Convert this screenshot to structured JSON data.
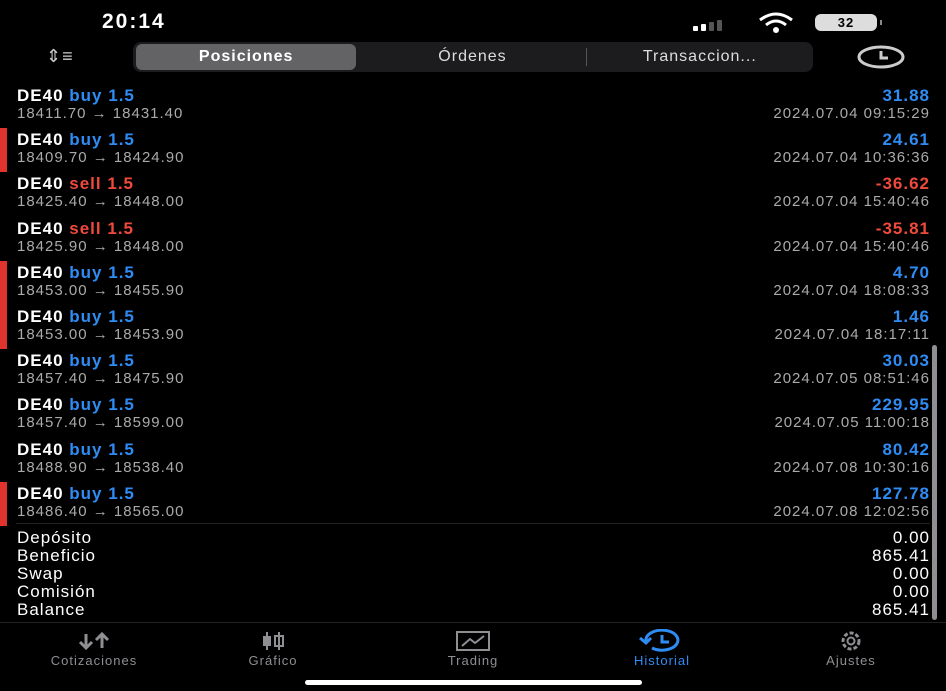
{
  "status": {
    "time": "20:14",
    "battery": "32"
  },
  "toolbar": {
    "tabs": [
      "Posiciones",
      "Órdenes",
      "Transaccion..."
    ],
    "active": 0
  },
  "colors": {
    "buy": "#2f8cf4",
    "sell": "#ef4a3c",
    "marker": "#e0342c"
  },
  "trades": [
    {
      "symbol": "DE40",
      "side": "buy",
      "volume": "1.5",
      "open": "18411.70",
      "close": "18431.40",
      "profit": "31.88",
      "time": "2024.07.04 09:15:29",
      "marked": false
    },
    {
      "symbol": "DE40",
      "side": "buy",
      "volume": "1.5",
      "open": "18409.70",
      "close": "18424.90",
      "profit": "24.61",
      "time": "2024.07.04 10:36:36",
      "marked": true
    },
    {
      "symbol": "DE40",
      "side": "sell",
      "volume": "1.5",
      "open": "18425.40",
      "close": "18448.00",
      "profit": "-36.62",
      "time": "2024.07.04 15:40:46",
      "marked": false
    },
    {
      "symbol": "DE40",
      "side": "sell",
      "volume": "1.5",
      "open": "18425.90",
      "close": "18448.00",
      "profit": "-35.81",
      "time": "2024.07.04 15:40:46",
      "marked": false
    },
    {
      "symbol": "DE40",
      "side": "buy",
      "volume": "1.5",
      "open": "18453.00",
      "close": "18455.90",
      "profit": "4.70",
      "time": "2024.07.04 18:08:33",
      "marked": true
    },
    {
      "symbol": "DE40",
      "side": "buy",
      "volume": "1.5",
      "open": "18453.00",
      "close": "18453.90",
      "profit": "1.46",
      "time": "2024.07.04 18:17:11",
      "marked": true
    },
    {
      "symbol": "DE40",
      "side": "buy",
      "volume": "1.5",
      "open": "18457.40",
      "close": "18475.90",
      "profit": "30.03",
      "time": "2024.07.05 08:51:46",
      "marked": false
    },
    {
      "symbol": "DE40",
      "side": "buy",
      "volume": "1.5",
      "open": "18457.40",
      "close": "18599.00",
      "profit": "229.95",
      "time": "2024.07.05 11:00:18",
      "marked": false
    },
    {
      "symbol": "DE40",
      "side": "buy",
      "volume": "1.5",
      "open": "18488.90",
      "close": "18538.40",
      "profit": "80.42",
      "time": "2024.07.08 10:30:16",
      "marked": false
    },
    {
      "symbol": "DE40",
      "side": "buy",
      "volume": "1.5",
      "open": "18486.40",
      "close": "18565.00",
      "profit": "127.78",
      "time": "2024.07.08 12:02:56",
      "marked": true
    }
  ],
  "summary": [
    {
      "label": "Depósito",
      "value": "0.00"
    },
    {
      "label": "Beneficio",
      "value": "865.41"
    },
    {
      "label": "Swap",
      "value": "0.00"
    },
    {
      "label": "Comisión",
      "value": "0.00"
    },
    {
      "label": "Balance",
      "value": "865.41"
    }
  ],
  "tabbar": [
    {
      "label": "Cotizaciones",
      "icon": "arrows-icon"
    },
    {
      "label": "Gráfico",
      "icon": "candles-icon"
    },
    {
      "label": "Trading",
      "icon": "trading-chart-icon"
    },
    {
      "label": "Historial",
      "icon": "history-icon",
      "active": true
    },
    {
      "label": "Ajustes",
      "icon": "gear-icon"
    }
  ]
}
